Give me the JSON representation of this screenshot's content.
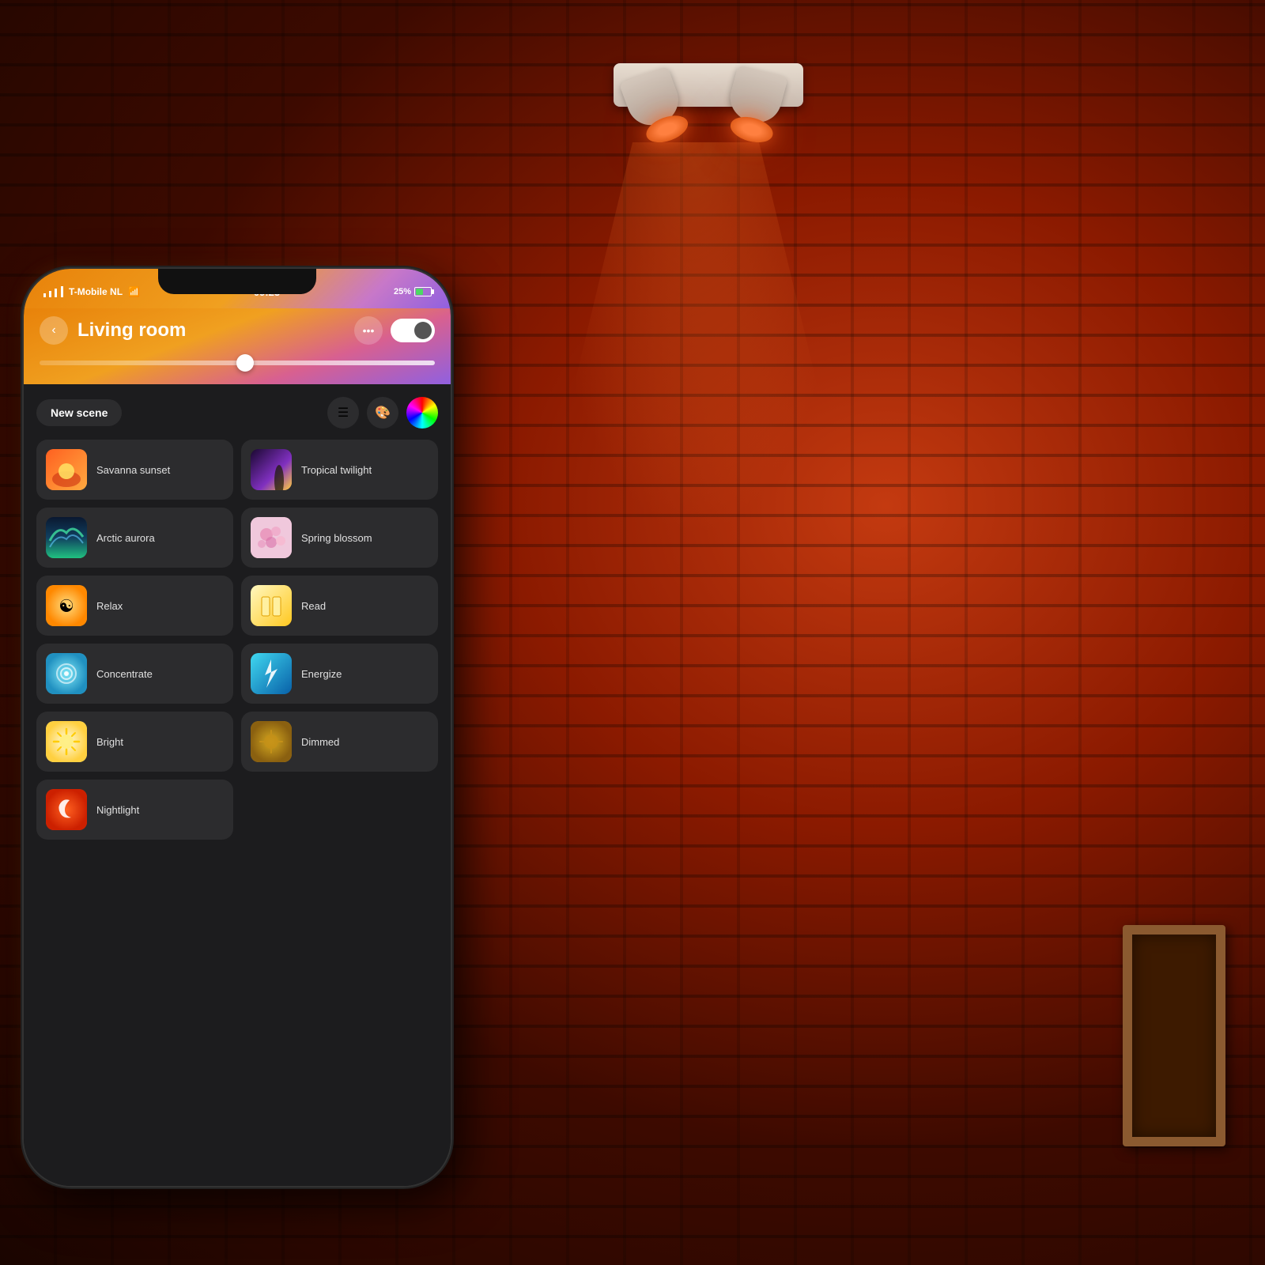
{
  "background": {
    "description": "brick wall with orange-red lighting"
  },
  "statusBar": {
    "carrier": "T-Mobile NL",
    "time": "09:23",
    "battery": "25%",
    "wifi": true
  },
  "header": {
    "backLabel": "‹",
    "title": "Living room",
    "moreLabel": "•••",
    "toggleOn": true
  },
  "toolbar": {
    "newSceneLabel": "New scene",
    "listIcon": "list-icon",
    "paletteIcon": "palette-icon",
    "colorWheelIcon": "color-wheel-icon"
  },
  "scenes": [
    {
      "id": "savanna-sunset",
      "label": "Savanna sunset",
      "thumbType": "savanna"
    },
    {
      "id": "tropical-twilight",
      "label": "Tropical twilight",
      "thumbType": "tropical"
    },
    {
      "id": "arctic-aurora",
      "label": "Arctic aurora",
      "thumbType": "arctic"
    },
    {
      "id": "spring-blossom",
      "label": "Spring blossom",
      "thumbType": "spring"
    },
    {
      "id": "relax",
      "label": "Relax",
      "thumbType": "relax"
    },
    {
      "id": "read",
      "label": "Read",
      "thumbType": "read"
    },
    {
      "id": "concentrate",
      "label": "Concentrate",
      "thumbType": "concentrate"
    },
    {
      "id": "energize",
      "label": "Energize",
      "thumbType": "energize"
    },
    {
      "id": "bright",
      "label": "Bright",
      "thumbType": "bright"
    },
    {
      "id": "dimmed",
      "label": "Dimmed",
      "thumbType": "dimmed"
    },
    {
      "id": "nightlight",
      "label": "Nightlight",
      "thumbType": "nightlight"
    }
  ]
}
